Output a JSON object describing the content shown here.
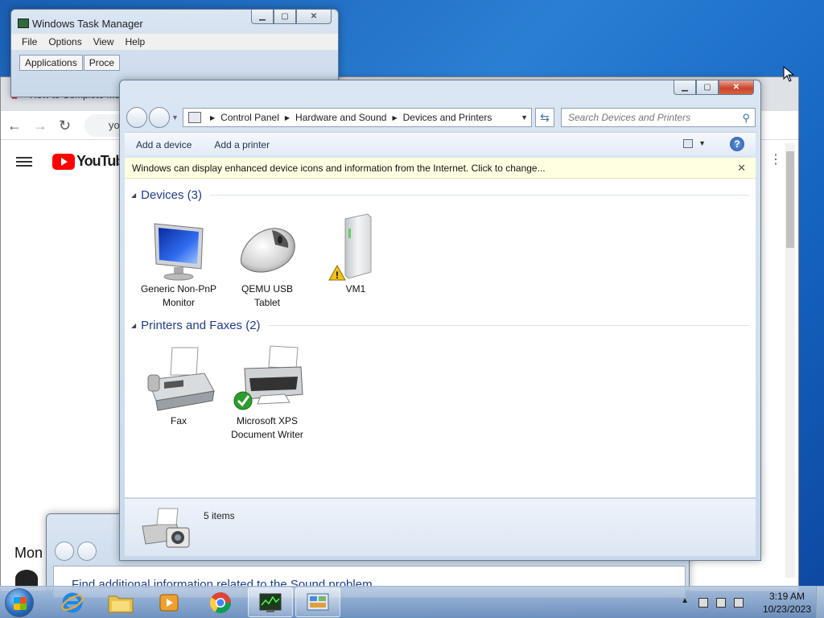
{
  "task_manager": {
    "title": "Windows Task Manager",
    "menu": [
      "File",
      "Options",
      "View",
      "Help"
    ],
    "tabs": [
      "Applications",
      "Proce"
    ]
  },
  "chrome": {
    "tab_title": "How to Complete Mo",
    "address_fragment": "yo",
    "yt_word": "YouTub",
    "section_text": "Mon"
  },
  "sound_window": {
    "link_text": "Find additional information related to the Sound problem"
  },
  "devices_window": {
    "breadcrumb": [
      "Control Panel",
      "Hardware and Sound",
      "Devices and Printers"
    ],
    "search_placeholder": "Search Devices and Printers",
    "commands": [
      "Add a device",
      "Add a printer"
    ],
    "info_bar": "Windows can display enhanced device icons and information from the Internet. Click to change...",
    "groups": [
      {
        "title": "Devices (3)"
      },
      {
        "title": "Printers and Faxes (2)"
      }
    ],
    "devices": [
      {
        "line1": "Generic Non-PnP",
        "line2": "Monitor",
        "icon": "monitor-icon"
      },
      {
        "line1": "QEMU USB",
        "line2": "Tablet",
        "icon": "mouse-icon"
      },
      {
        "line1": "VM1",
        "line2": "",
        "icon": "computer-tower-icon",
        "warning": true
      }
    ],
    "printers": [
      {
        "line1": "Fax",
        "line2": "",
        "icon": "fax-icon"
      },
      {
        "line1": "Microsoft XPS",
        "line2": "Document Writer",
        "icon": "printer-icon",
        "default": true
      }
    ],
    "item_count": "5 items"
  },
  "taskbar": {
    "time": "3:19 AM",
    "date": "10/23/2023",
    "apps": [
      "internet-explorer-icon",
      "file-explorer-icon",
      "media-player-icon",
      "chrome-icon",
      "task-manager-icon",
      "control-panel-icon"
    ]
  }
}
